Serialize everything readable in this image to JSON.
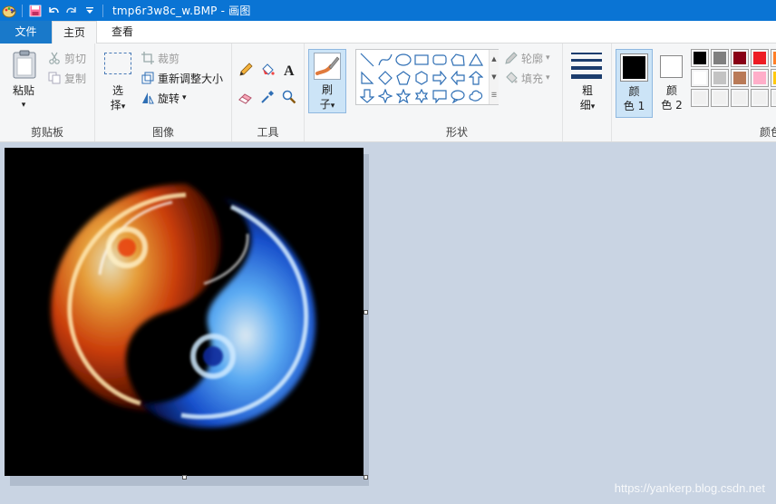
{
  "window": {
    "title": "tmp6r3w8c_w.BMP - 画图"
  },
  "quick_access": {
    "icons": [
      "paint-app-icon",
      "save-icon",
      "undo-icon",
      "redo-icon",
      "customize-dropdown-icon"
    ]
  },
  "tabs": [
    {
      "label": "文件"
    },
    {
      "label": "主页"
    },
    {
      "label": "查看"
    }
  ],
  "ribbon": {
    "clipboard": {
      "group_label": "剪贴板",
      "paste_line1": "粘贴",
      "paste_arrow": "▾",
      "cut": "剪切",
      "copy": "复制"
    },
    "image": {
      "group_label": "图像",
      "select_line1": "选",
      "select_line2": "择",
      "select_arrow": "▾",
      "crop": "裁剪",
      "resize": "重新调整大小",
      "rotate": "旋转",
      "rotate_arrow": "▾"
    },
    "tools": {
      "group_label": "工具"
    },
    "brushes": {
      "line1": "刷",
      "line2": "子",
      "arrow": "▾"
    },
    "shapes": {
      "group_label": "形状",
      "outline": "轮廓",
      "fill": "填充",
      "outline_arrow": "▾",
      "fill_arrow": "▾"
    },
    "size": {
      "line1": "粗",
      "line2": "细",
      "arrow": "▾"
    },
    "color1": {
      "line1": "颜",
      "line2": "色 1",
      "value": "#000000"
    },
    "color2": {
      "line1": "颜",
      "line2": "色 2",
      "value": "#ffffff"
    },
    "colors": {
      "group_label": "颜色",
      "palette_row1": [
        "#000000",
        "#7f7f7f",
        "#880015",
        "#ed1c24",
        "#ff7f27"
      ],
      "palette_row2": [
        "#ffffff",
        "#c3c3c3",
        "#b97a57",
        "#ffaec9",
        "#ffc90e"
      ],
      "palette_row3": [
        "#f0f0f0",
        "#f0f0f0",
        "#f0f0f0",
        "#f0f0f0",
        "#f0f0f0"
      ]
    }
  },
  "canvas": {
    "image_description_icon": "yin-yang-fire-image"
  },
  "watermark": "https://yankerp.blog.csdn.net"
}
